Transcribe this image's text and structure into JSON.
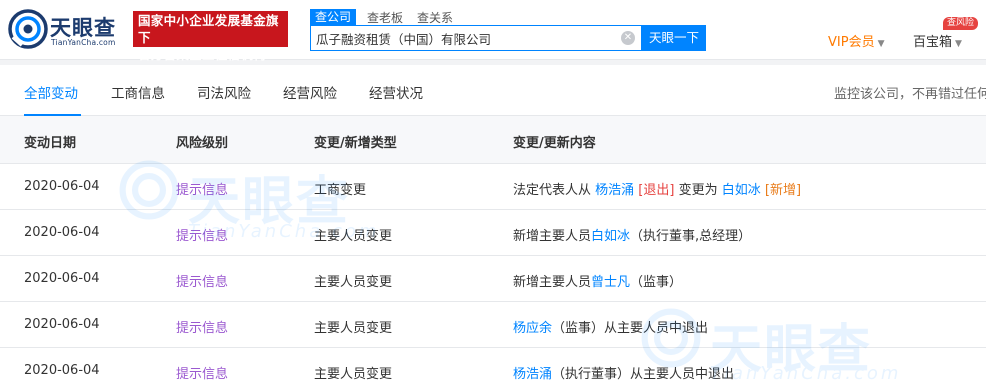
{
  "logo": {
    "name_cn": "天眼查",
    "name_en": "TianYanCha.com"
  },
  "banner": {
    "line1": "国家中小企业发展基金旗下",
    "line2": "官方备案企业征信机构"
  },
  "search": {
    "tabs": [
      "查公司",
      "查老板",
      "查关系"
    ],
    "value": "瓜子融资租赁（中国）有限公司",
    "button": "天眼一下"
  },
  "header": {
    "risk_badge": "查风险",
    "vip": "VIP会员",
    "baibao": "百宝箱"
  },
  "tabs": [
    {
      "label": "全部变动",
      "active": true
    },
    {
      "label": "工商信息"
    },
    {
      "label": "司法风险"
    },
    {
      "label": "经营风险"
    },
    {
      "label": "经营状况"
    }
  ],
  "monitor_text": "监控该公司，不再错过任何",
  "table": {
    "headers": [
      "变动日期",
      "风险级别",
      "变更/新增类型",
      "变更/更新内容"
    ],
    "rows": [
      {
        "date": "2020-06-04",
        "risk": "提示信息",
        "type": "工商变更"
      },
      {
        "date": "2020-06-04",
        "risk": "提示信息",
        "type": "主要人员变更"
      },
      {
        "date": "2020-06-04",
        "risk": "提示信息",
        "type": "主要人员变更"
      },
      {
        "date": "2020-06-04",
        "risk": "提示信息",
        "type": "主要人员变更"
      },
      {
        "date": "2020-06-04",
        "risk": "提示信息",
        "type": "主要人员变更"
      }
    ],
    "contents": [
      {
        "p1": "法定代表人从 ",
        "name1": "杨浩涌",
        "tag1": "[退出]",
        "p2": " 变更为 ",
        "name2": "白如冰",
        "tag2": "[新增]"
      },
      {
        "p1": "新增主要人员",
        "name": "白如冰",
        "p2": "（执行董事,总经理）"
      },
      {
        "p1": "新增主要人员",
        "name": "曾士凡",
        "p2": "（监事）"
      },
      {
        "name": "杨应余",
        "p2": "（监事）从主要人员中退出"
      },
      {
        "name": "杨浩涌",
        "p2": "（执行董事）从主要人员中退出"
      }
    ]
  },
  "watermark": {
    "cn": "天眼查",
    "en": "TianYanCha.com"
  },
  "colors": {
    "accent": "#0084ff",
    "risk_purple": "#9b59d0",
    "brand_navy": "#1c3b6e",
    "banner_red": "#c8161d"
  },
  "icons": {
    "logo": "eye-logo-icon",
    "clear": "clear-icon",
    "caret": "caret-down-icon"
  }
}
